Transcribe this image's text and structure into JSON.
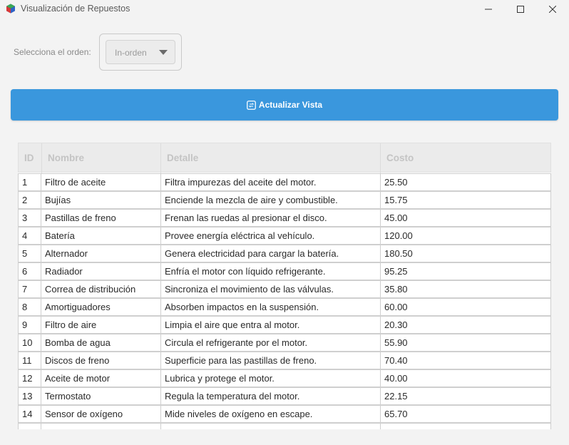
{
  "window": {
    "title": "Visualización de Repuestos",
    "icon": "app-cube-icon"
  },
  "order": {
    "label": "Selecciona el orden:",
    "selected": "In-orden"
  },
  "refresh": {
    "label": "Actualizar Vista",
    "icon": "refresh-icon",
    "color": "#3a97dd"
  },
  "table": {
    "columns": [
      "ID",
      "Nombre",
      "Detalle",
      "Costo"
    ],
    "rows": [
      {
        "id": "1",
        "nombre": "Filtro de aceite",
        "detalle": "Filtra impurezas del aceite del motor.",
        "costo": "25.50"
      },
      {
        "id": "2",
        "nombre": "Bujías",
        "detalle": "Enciende la mezcla de aire y combustible.",
        "costo": "15.75"
      },
      {
        "id": "3",
        "nombre": "Pastillas de freno",
        "detalle": "Frenan las ruedas al presionar el disco.",
        "costo": "45.00"
      },
      {
        "id": "4",
        "nombre": "Batería",
        "detalle": "Provee energía eléctrica al vehículo.",
        "costo": "120.00"
      },
      {
        "id": "5",
        "nombre": "Alternador",
        "detalle": "Genera electricidad para cargar la batería.",
        "costo": "180.50"
      },
      {
        "id": "6",
        "nombre": "Radiador",
        "detalle": "Enfría el motor con líquido refrigerante.",
        "costo": "95.25"
      },
      {
        "id": "7",
        "nombre": "Correa de distribución",
        "detalle": "Sincroniza el movimiento de las válvulas.",
        "costo": "35.80"
      },
      {
        "id": "8",
        "nombre": "Amortiguadores",
        "detalle": "Absorben impactos en la suspensión.",
        "costo": "60.00"
      },
      {
        "id": "9",
        "nombre": "Filtro de aire",
        "detalle": "Limpia el aire que entra al motor.",
        "costo": "20.30"
      },
      {
        "id": "10",
        "nombre": "Bomba de agua",
        "detalle": "Circula el refrigerante por el motor.",
        "costo": "55.90"
      },
      {
        "id": "11",
        "nombre": "Discos de freno",
        "detalle": "Superficie para las pastillas de freno.",
        "costo": "70.40"
      },
      {
        "id": "12",
        "nombre": "Aceite de motor",
        "detalle": "Lubrica y protege el motor.",
        "costo": "40.00"
      },
      {
        "id": "13",
        "nombre": "Termostato",
        "detalle": "Regula la temperatura del motor.",
        "costo": "22.15"
      },
      {
        "id": "14",
        "nombre": "Sensor de oxígeno",
        "detalle": "Mide niveles de oxígeno en escape.",
        "costo": "65.70"
      },
      {
        "id": "",
        "nombre": "",
        "detalle": "",
        "costo": ""
      }
    ]
  }
}
